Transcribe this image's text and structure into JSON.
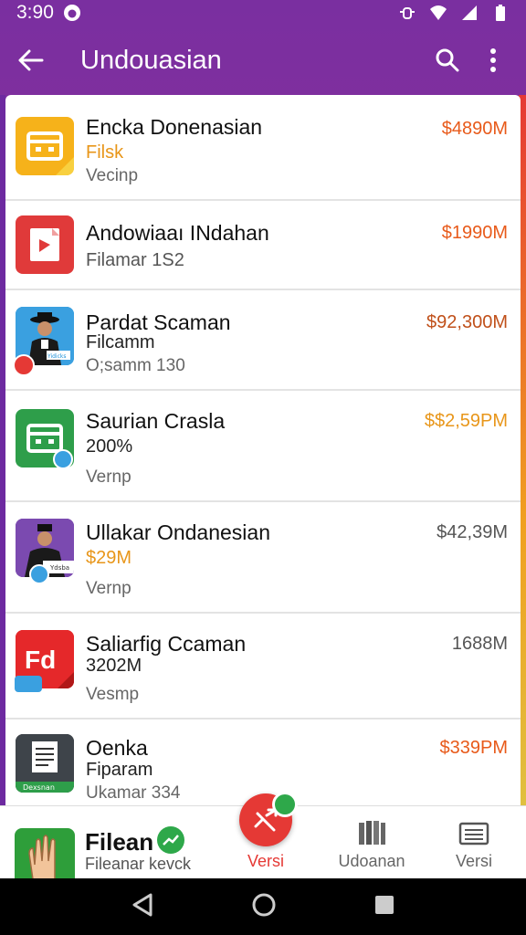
{
  "status_bar": {
    "time": "3:90"
  },
  "app_bar": {
    "title": "Undouasian"
  },
  "colors": {
    "accent_red": "#e53935",
    "accent_orange": "#e8961a",
    "purple": "#7a2fa0"
  },
  "rows": [
    {
      "title": "Encka Donenasian",
      "sub": "Filsk",
      "meta": "Vecinp",
      "price": "$4890M",
      "icon": "calendar-icon"
    },
    {
      "title": "Andowiaaı INdahan",
      "sub": "Filamar 1S2",
      "meta": "",
      "price": "$1990M",
      "icon": "play-icon"
    },
    {
      "title": "Pardat Scaman",
      "sub": "Filcamm",
      "meta": "O;samm 130",
      "price": "$92,300M",
      "icon": "person-icon"
    },
    {
      "title": "Saurian Crasla",
      "sub": "200%",
      "meta": "Vernp",
      "price": "$$2,59PM",
      "icon": "calendar-icon"
    },
    {
      "title": "Ullakar Ondanesian",
      "sub": "$29M",
      "meta": "Vernp",
      "price": "$42,39M",
      "icon": "person-icon"
    },
    {
      "title": "Saliarfig Ccaman",
      "sub": "3202M",
      "meta": "Vesmp",
      "price": "1688M",
      "icon": "fd-icon"
    },
    {
      "title": "Oenka",
      "sub": "Fiparam",
      "meta": "Ukamar 334",
      "price": "$339PM",
      "icon": "document-icon"
    }
  ],
  "partial_row": {
    "title": "Filean",
    "sub": "Fileanar kevck"
  },
  "bottom_nav": {
    "fab_label": "Versi",
    "item2_label": "Udoanan",
    "item3_label": "Versi"
  },
  "icon_texts": {
    "row3_tag": "Yidicks",
    "row5_tag": "Ydsba",
    "row6_logo": "Fd",
    "row7_tag": "Dexsnan"
  }
}
